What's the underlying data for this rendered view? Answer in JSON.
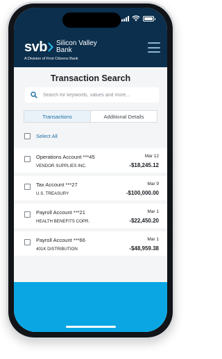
{
  "status_bar": {
    "time": ""
  },
  "brand": {
    "logo_text": "svb",
    "name_line1": "Silicon Valley",
    "name_line2": "Bank",
    "division": "A Division of First Citizens Bank"
  },
  "page": {
    "title": "Transaction Search"
  },
  "search": {
    "placeholder": "Search for keywords, values and more..."
  },
  "tabs": [
    {
      "label": "Transactions",
      "active": true
    },
    {
      "label": "Additional Details",
      "active": false
    }
  ],
  "select_all_label": "Select All",
  "transactions": [
    {
      "account": "Operations Account ***45",
      "date": "Mar 12",
      "description": "VENDOR SUPPLIES INC.",
      "amount": "-$18,245.12"
    },
    {
      "account": "Tax Account ***27",
      "date": "Mar 9",
      "description": "U.S. TREASURY",
      "amount": "-$100,000.00"
    },
    {
      "account": "Payroll Account ***21",
      "date": "Mar 1",
      "description": "HEALTH BENEFITS COPR.",
      "amount": "-$22,450.20"
    },
    {
      "account": "Payroll Account ***66",
      "date": "Mar 1",
      "description": "401K DISTRIBUTION",
      "amount": "-$48,959.38"
    }
  ],
  "colors": {
    "header_bg": "#0b2f4d",
    "accent_blue": "#1d6ea5",
    "footer_bg": "#0aa6e3",
    "logo_chevron": "#2ab5e8"
  }
}
